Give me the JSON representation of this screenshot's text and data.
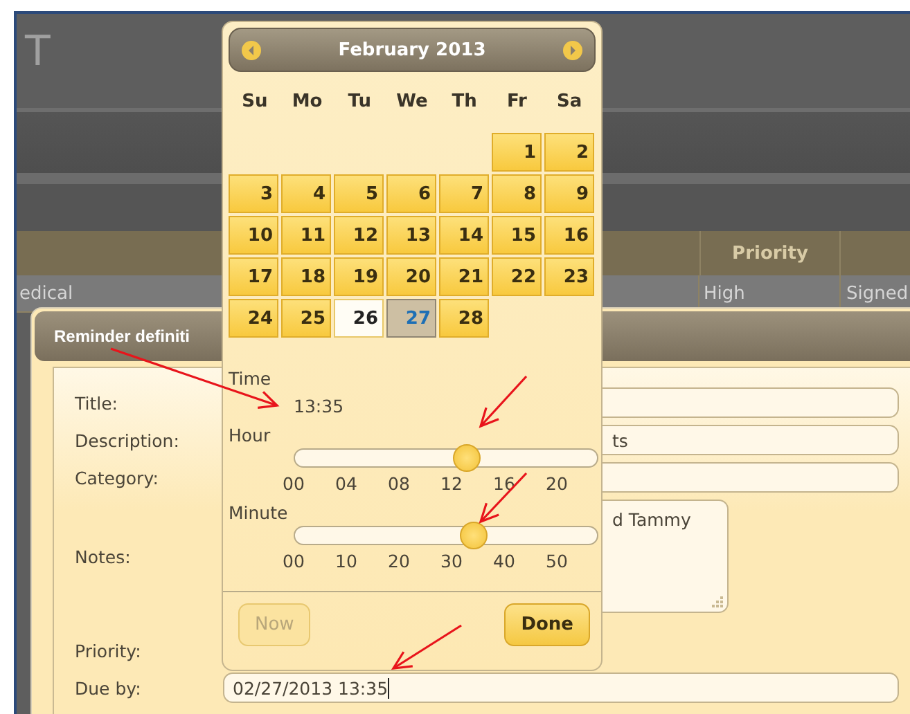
{
  "app": {
    "title": "T",
    "grid": {
      "columns": [
        {
          "label": "Priority"
        }
      ],
      "rows": [
        [
          "edical",
          "High",
          "Signed"
        ]
      ]
    }
  },
  "dialog": {
    "title": "Reminder definiti",
    "fields": [
      {
        "label": "Title:",
        "kind": "text"
      },
      {
        "label": "Description:",
        "kind": "text",
        "value": "ts"
      },
      {
        "label": "Category:",
        "kind": "text"
      },
      {
        "label": "Notes:",
        "kind": "notes",
        "value": "d Tammy"
      },
      {
        "label": "Priority:",
        "kind": "hidden"
      },
      {
        "label": "Due by:",
        "kind": "date",
        "value": "02/27/2013 13:35"
      }
    ]
  },
  "calendar": {
    "month": "February 2013",
    "weekdays": [
      "Su",
      "Mo",
      "Tu",
      "We",
      "Th",
      "Fr",
      "Sa"
    ],
    "weeks": [
      [
        {
          "kind": "blank"
        },
        {
          "kind": "blank"
        },
        {
          "kind": "blank"
        },
        {
          "kind": "blank"
        },
        {
          "kind": "blank"
        },
        {
          "kind": "day",
          "label": "1",
          "selected": false,
          "today": false
        },
        {
          "kind": "day",
          "label": "2",
          "selected": false,
          "today": false
        }
      ],
      [
        {
          "kind": "day",
          "label": "3",
          "selected": false,
          "today": false
        },
        {
          "kind": "day",
          "label": "4",
          "selected": false,
          "today": false
        },
        {
          "kind": "day",
          "label": "5",
          "selected": false,
          "today": false
        },
        {
          "kind": "day",
          "label": "6",
          "selected": false,
          "today": false
        },
        {
          "kind": "day",
          "label": "7",
          "selected": false,
          "today": false
        },
        {
          "kind": "day",
          "label": "8",
          "selected": false,
          "today": false
        },
        {
          "kind": "day",
          "label": "9",
          "selected": false,
          "today": false
        }
      ],
      [
        {
          "kind": "day",
          "label": "10",
          "selected": false,
          "today": false
        },
        {
          "kind": "day",
          "label": "11",
          "selected": false,
          "today": false
        },
        {
          "kind": "day",
          "label": "12",
          "selected": false,
          "today": false
        },
        {
          "kind": "day",
          "label": "13",
          "selected": false,
          "today": false
        },
        {
          "kind": "day",
          "label": "14",
          "selected": false,
          "today": false
        },
        {
          "kind": "day",
          "label": "15",
          "selected": false,
          "today": false
        },
        {
          "kind": "day",
          "label": "16",
          "selected": false,
          "today": false
        }
      ],
      [
        {
          "kind": "day",
          "label": "17",
          "selected": false,
          "today": false
        },
        {
          "kind": "day",
          "label": "18",
          "selected": false,
          "today": false
        },
        {
          "kind": "day",
          "label": "19",
          "selected": false,
          "today": false
        },
        {
          "kind": "day",
          "label": "20",
          "selected": false,
          "today": false
        },
        {
          "kind": "day",
          "label": "21",
          "selected": false,
          "today": false
        },
        {
          "kind": "day",
          "label": "22",
          "selected": false,
          "today": false
        },
        {
          "kind": "day",
          "label": "23",
          "selected": false,
          "today": false
        }
      ],
      [
        {
          "kind": "day",
          "label": "24",
          "selected": false,
          "today": false
        },
        {
          "kind": "day",
          "label": "25",
          "selected": false,
          "today": false
        },
        {
          "kind": "day",
          "label": "26",
          "selected": false,
          "today": true
        },
        {
          "kind": "day",
          "label": "27",
          "selected": true,
          "today": false
        },
        {
          "kind": "day",
          "label": "28",
          "selected": false,
          "today": false
        }
      ]
    ],
    "time_label": "Time",
    "time": "13:35",
    "sliders": [
      {
        "label": "Hour",
        "level": 0.57,
        "ticks": [
          "00",
          "04",
          "08",
          "12",
          "16",
          "20"
        ]
      },
      {
        "label": "Minute",
        "level": 0.59,
        "ticks": [
          "00",
          "10",
          "20",
          "30",
          "40",
          "50"
        ]
      }
    ],
    "buttons": [
      {
        "label": "Now",
        "disabled": true
      },
      {
        "label": "Done",
        "disabled": false
      }
    ]
  }
}
